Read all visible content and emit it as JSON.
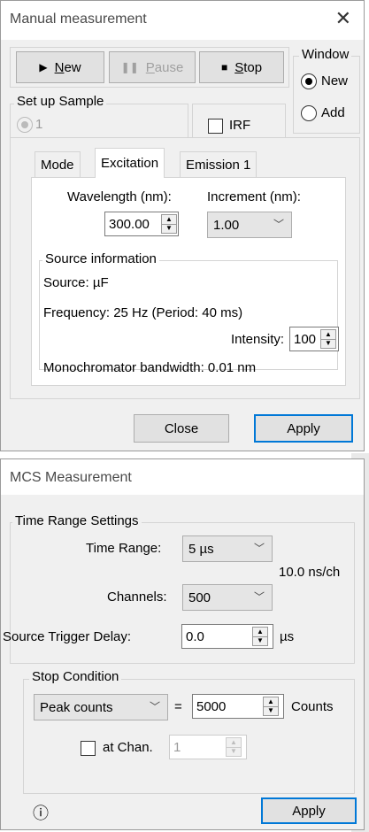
{
  "manual": {
    "title": "Manual measurement",
    "close_glyph": "✕",
    "toolbar": {
      "new_label": "New",
      "new_key": "N",
      "new_rest": "ew",
      "pause_key": "P",
      "pause_rest": "ause",
      "stop_key": "S",
      "stop_rest": "top"
    },
    "window_group": {
      "legend": "Window",
      "options": [
        {
          "label": "New",
          "checked": true
        },
        {
          "label": "Add",
          "checked": false
        }
      ]
    },
    "setup_sample": {
      "legend": "Set up Sample",
      "radio_label": "1",
      "irf_label": "IRF"
    },
    "tabs": [
      {
        "label": "Mode",
        "active": false
      },
      {
        "label": "Excitation",
        "active": true
      },
      {
        "label": "Emission 1",
        "active": false
      }
    ],
    "excitation": {
      "wavelength_label": "Wavelength (nm):",
      "wavelength_value": "300.00",
      "increment_label": "Increment (nm):",
      "increment_value": "1.00",
      "source_info_legend": "Source information",
      "source_line": "Source:  µF",
      "frequency_line": "Frequency: 25 Hz (Period: 40 ms)",
      "intensity_label": "Intensity:",
      "intensity_value": "100",
      "bandwidth_line": "Monochromator bandwidth: 0.01 nm"
    },
    "close_button": "Close",
    "apply_button": "Apply"
  },
  "mcs": {
    "title": "MCS Measurement",
    "time_range_group": {
      "legend": "Time Range Settings",
      "time_range_label": "Time Range:",
      "time_range_value": "5 µs",
      "channels_label": "Channels:",
      "channels_value": "500",
      "per_channel": "10.0 ns/ch",
      "trigger_label": "Source Trigger Delay:",
      "trigger_value": "0.0",
      "trigger_unit": "µs"
    },
    "stop_group": {
      "legend": "Stop Condition",
      "condition_value": "Peak counts",
      "equals": "=",
      "count_value": "5000",
      "count_unit": "Counts",
      "at_chan_label": "at Chan.",
      "at_chan_value": "1"
    },
    "info_glyph": "ⓘ",
    "apply_button": "Apply"
  },
  "colors": {
    "window_bg": "#f0f0f0",
    "focus_border": "#0078d7"
  }
}
